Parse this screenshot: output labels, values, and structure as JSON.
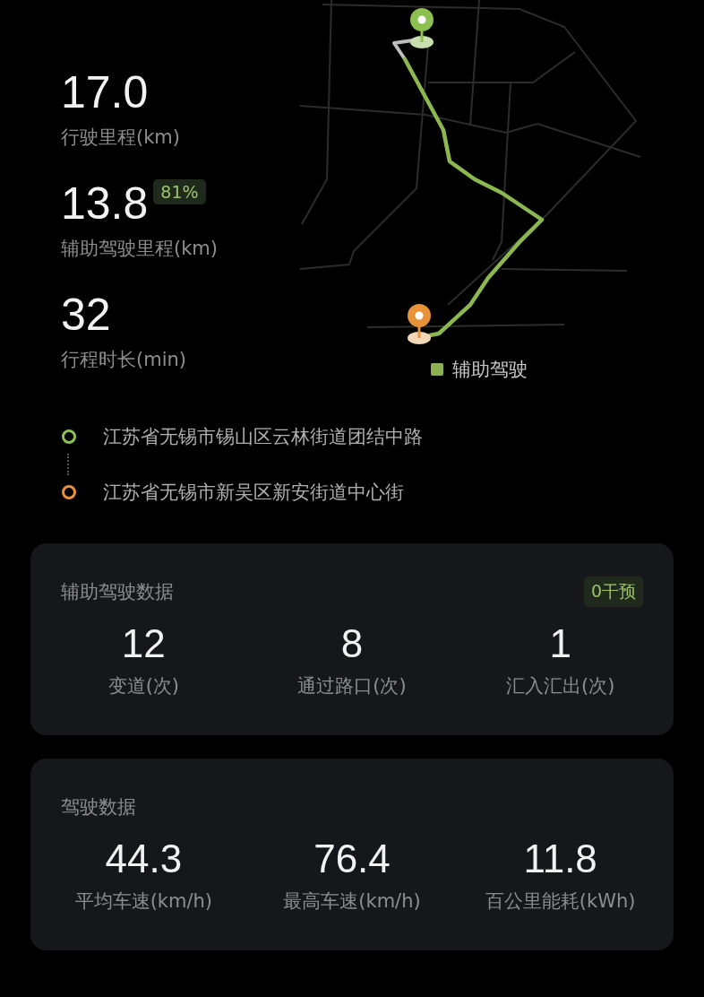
{
  "trip_stats": [
    {
      "value": "17.0",
      "label": "行驶里程(km)"
    },
    {
      "value": "13.8",
      "label": "辅助驾驶里程(km)",
      "badge": "81%"
    },
    {
      "value": "32",
      "label": "行程时长(min)"
    }
  ],
  "map": {
    "legend": "辅助驾驶"
  },
  "route": [
    {
      "kind": "start",
      "address": "江苏省无锡市锡山区云林街道团结中路",
      "color": "#8cc152"
    },
    {
      "kind": "end",
      "address": "江苏省无锡市新吴区新安街道中心街",
      "color": "#e8923a"
    }
  ],
  "cards": [
    {
      "title": "辅助驾驶数据",
      "badge": "0干预",
      "stats": [
        {
          "value": "12",
          "label": "变道(次)"
        },
        {
          "value": "8",
          "label": "通过路口(次)"
        },
        {
          "value": "1",
          "label": "汇入汇出(次)"
        }
      ]
    },
    {
      "title": "驾驶数据",
      "stats": [
        {
          "value": "44.3",
          "label": "平均车速(km/h)"
        },
        {
          "value": "76.4",
          "label": "最高车速(km/h)"
        },
        {
          "value": "11.8",
          "label": "百公里能耗(kWh)"
        }
      ]
    }
  ]
}
